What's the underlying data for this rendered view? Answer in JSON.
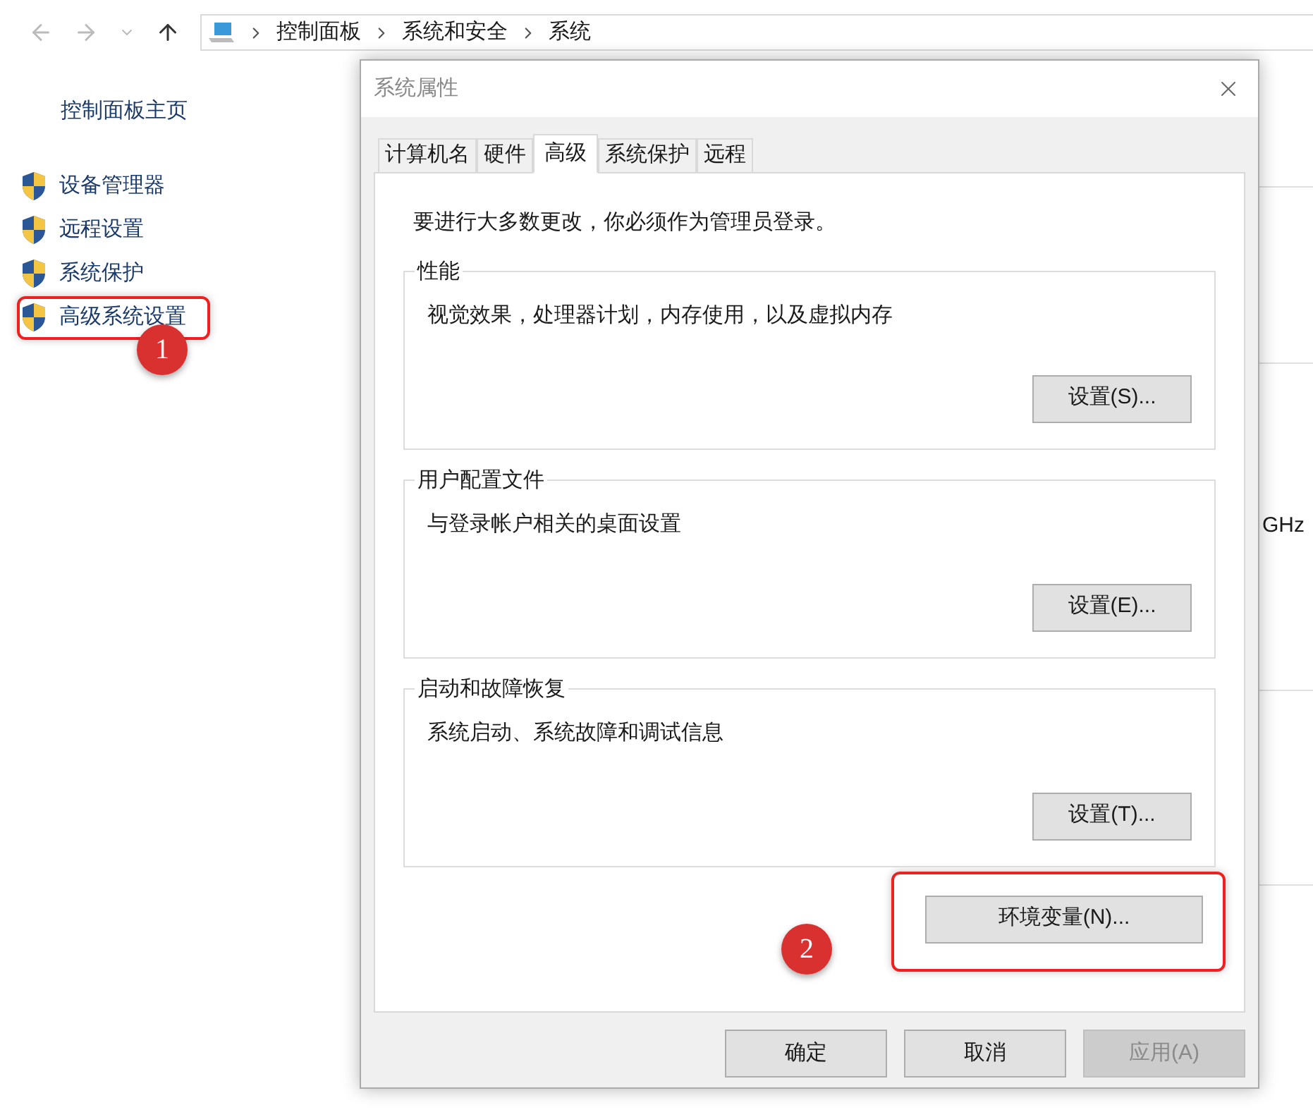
{
  "nav": {
    "breadcrumb": [
      "控制面板",
      "系统和安全",
      "系统"
    ]
  },
  "sidebar": {
    "home_link": "控制面板主页",
    "items": [
      {
        "label": "设备管理器"
      },
      {
        "label": "远程设置"
      },
      {
        "label": "系统保护"
      },
      {
        "label": "高级系统设置"
      }
    ]
  },
  "background_fragment": "GHz",
  "dialog": {
    "title": "系统属性",
    "tabs": [
      {
        "label": "计算机名",
        "selected": false
      },
      {
        "label": "硬件",
        "selected": false
      },
      {
        "label": "高级",
        "selected": true
      },
      {
        "label": "系统保护",
        "selected": false
      },
      {
        "label": "远程",
        "selected": false
      }
    ],
    "notice": "要进行大多数更改，你必须作为管理员登录。",
    "groups": [
      {
        "title": "性能",
        "description": "视觉效果，处理器计划，内存使用，以及虚拟内存",
        "button": "设置(S)..."
      },
      {
        "title": "用户配置文件",
        "description": "与登录帐户相关的桌面设置",
        "button": "设置(E)..."
      },
      {
        "title": "启动和故障恢复",
        "description": "系统启动、系统故障和调试信息",
        "button": "设置(T)..."
      }
    ],
    "env_button": "环境变量(N)...",
    "buttons": [
      {
        "label": "确定",
        "disabled": false
      },
      {
        "label": "取消",
        "disabled": false
      },
      {
        "label": "应用(A)",
        "disabled": true
      }
    ]
  },
  "annotations": [
    {
      "label": "1"
    },
    {
      "label": "2"
    }
  ]
}
